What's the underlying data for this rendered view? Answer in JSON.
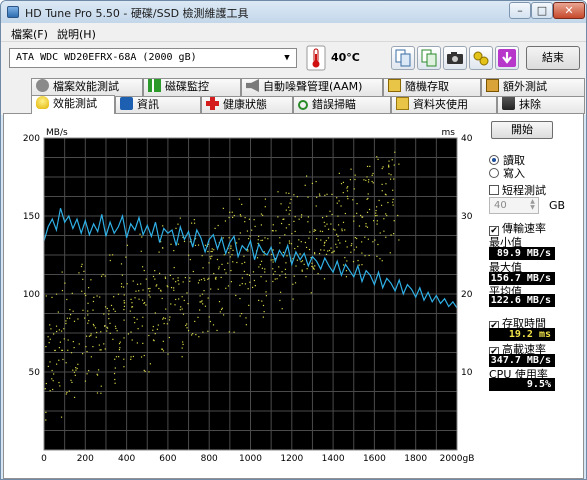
{
  "window": {
    "title": "HD Tune Pro 5.50 - 硬碟/SSD 檢測維護工具",
    "minimize": "–",
    "maximize": "□",
    "close": "✕"
  },
  "menu": [
    "檔案(F)",
    "說明(H)"
  ],
  "toolbar": {
    "drive": "ATA    WDC WD20EFRX-68A (2000 gB)",
    "temperature": "40°C",
    "exit_label": "結束"
  },
  "tabs_row1": [
    "檔案效能測試",
    "磁碟監控",
    "自動噪聲管理(AAM)",
    "隨機存取",
    "額外測試"
  ],
  "tabs_row2": [
    "效能測試",
    "資訊",
    "健康狀態",
    "錯誤掃瞄",
    "資料夾使用",
    "抹除"
  ],
  "controls": {
    "start_label": "開始",
    "read_label": "讀取",
    "write_label": "寫入",
    "short_test_label": "短程測試",
    "short_test_value": "40",
    "short_test_unit": "GB",
    "transfer_rate_label": "傳輸速率",
    "min_label": "最小值",
    "min_value": "89.9 MB/s",
    "max_label": "最大值",
    "max_value": "156.7 MB/s",
    "avg_label": "平均值",
    "avg_value": "122.6 MB/s",
    "access_time_label": "存取時間",
    "access_time_value": "19.2 ms",
    "burst_rate_label": "高載速率",
    "burst_rate_value": "347.7 MB/s",
    "cpu_label": "CPU 使用率",
    "cpu_value": "9.5%"
  },
  "chart_data": {
    "type": "line",
    "ylabel": "MB/s",
    "y2label": "ms",
    "ylim": [
      0,
      200
    ],
    "y2lim": [
      0,
      40
    ],
    "yticks": [
      50,
      100,
      150,
      200
    ],
    "y2ticks": [
      10,
      20,
      30,
      40
    ],
    "xticks": [
      "0",
      "200",
      "400",
      "600",
      "800",
      "1000",
      "1200",
      "1400",
      "1600",
      "1800",
      "2000gB"
    ],
    "xlim": [
      0,
      2000
    ],
    "grid": true,
    "colors": {
      "line": "#2fb0e6",
      "points": "#d8d84a",
      "background": "#000000",
      "grid": "#4a4a4a"
    },
    "series": [
      {
        "values_x": [
          0,
          20,
          40,
          60,
          80,
          100,
          120,
          140,
          160,
          180,
          200,
          220,
          240,
          260,
          280,
          300,
          320,
          340,
          360,
          380,
          400,
          420,
          440,
          460,
          480,
          500,
          520,
          540,
          560,
          580,
          600,
          620,
          640,
          660,
          680,
          700,
          720,
          740,
          760,
          780,
          800,
          820,
          840,
          860,
          880,
          900,
          920,
          940,
          960,
          980,
          1000,
          1020,
          1040,
          1060,
          1080,
          1100,
          1120,
          1140,
          1160,
          1180,
          1200,
          1220,
          1240,
          1260,
          1280,
          1300,
          1320,
          1340,
          1360,
          1380,
          1400,
          1420,
          1440,
          1460,
          1480,
          1500,
          1520,
          1540,
          1560,
          1580,
          1600,
          1620,
          1640,
          1660,
          1680,
          1700,
          1720,
          1740,
          1760,
          1780,
          1800,
          1820,
          1840,
          1860,
          1880,
          1900,
          1920,
          1940,
          1960,
          1980,
          2000
        ],
        "values_y": [
          134,
          143,
          148,
          141,
          155,
          146,
          150,
          142,
          148,
          139,
          147,
          138,
          145,
          140,
          151,
          137,
          146,
          139,
          143,
          150,
          136,
          145,
          141,
          149,
          138,
          144,
          137,
          146,
          133,
          142,
          139,
          141,
          131,
          143,
          135,
          140,
          130,
          141,
          136,
          127,
          135,
          138,
          129,
          136,
          126,
          133,
          137,
          124,
          131,
          128,
          134,
          122,
          132,
          127,
          125,
          130,
          121,
          128,
          124,
          131,
          119,
          127,
          122,
          126,
          118,
          124,
          121,
          116,
          123,
          118,
          114,
          121,
          112,
          119,
          115,
          111,
          118,
          108,
          115,
          112,
          106,
          114,
          104,
          110,
          107,
          102,
          109,
          100,
          106,
          103,
          98,
          104,
          96,
          101,
          95,
          99,
          94,
          97,
          92,
          95,
          91
        ]
      }
    ],
    "access_time_points_ms": [
      [
        0,
        9
      ],
      [
        20,
        14
      ],
      [
        40,
        11
      ],
      [
        60,
        16
      ],
      [
        80,
        10
      ],
      [
        100,
        17
      ],
      [
        120,
        13
      ],
      [
        140,
        15
      ],
      [
        160,
        12
      ],
      [
        180,
        18
      ],
      [
        200,
        14
      ],
      [
        220,
        16
      ],
      [
        240,
        19
      ],
      [
        260,
        13
      ],
      [
        280,
        17
      ],
      [
        300,
        15
      ],
      [
        320,
        20
      ],
      [
        340,
        14
      ],
      [
        360,
        18
      ],
      [
        380,
        16
      ],
      [
        400,
        21
      ],
      [
        420,
        15
      ],
      [
        440,
        19
      ],
      [
        460,
        17
      ],
      [
        480,
        22
      ],
      [
        500,
        16
      ],
      [
        520,
        20
      ],
      [
        540,
        18
      ],
      [
        560,
        23
      ],
      [
        580,
        17
      ],
      [
        600,
        21
      ],
      [
        620,
        19
      ],
      [
        640,
        24
      ],
      [
        660,
        18
      ],
      [
        680,
        22
      ],
      [
        700,
        20
      ],
      [
        720,
        24
      ],
      [
        740,
        19
      ],
      [
        760,
        23
      ],
      [
        780,
        21
      ],
      [
        800,
        25
      ],
      [
        820,
        20
      ],
      [
        840,
        24
      ],
      [
        860,
        22
      ],
      [
        880,
        26
      ],
      [
        900,
        21
      ],
      [
        920,
        25
      ],
      [
        940,
        23
      ],
      [
        960,
        27
      ],
      [
        980,
        22
      ],
      [
        1000,
        26
      ],
      [
        1020,
        24
      ],
      [
        1040,
        27
      ],
      [
        1060,
        23
      ],
      [
        1080,
        27
      ],
      [
        1100,
        25
      ],
      [
        1120,
        28
      ],
      [
        1140,
        24
      ],
      [
        1160,
        28
      ],
      [
        1180,
        26
      ],
      [
        1200,
        29
      ],
      [
        1220,
        25
      ],
      [
        1240,
        28
      ],
      [
        1260,
        27
      ],
      [
        1280,
        30
      ],
      [
        1300,
        26
      ],
      [
        1320,
        29
      ],
      [
        1340,
        28
      ],
      [
        1360,
        30
      ],
      [
        1380,
        27
      ],
      [
        1400,
        30
      ],
      [
        1420,
        29
      ],
      [
        1440,
        31
      ],
      [
        1460,
        28
      ],
      [
        1480,
        31
      ],
      [
        1500,
        30
      ],
      [
        1520,
        32
      ],
      [
        1540,
        29
      ],
      [
        1560,
        32
      ],
      [
        1580,
        31
      ],
      [
        1600,
        32
      ],
      [
        1620,
        30
      ],
      [
        1640,
        33
      ],
      [
        1660,
        31
      ],
      [
        1680,
        32
      ],
      [
        1700,
        33
      ]
    ]
  }
}
